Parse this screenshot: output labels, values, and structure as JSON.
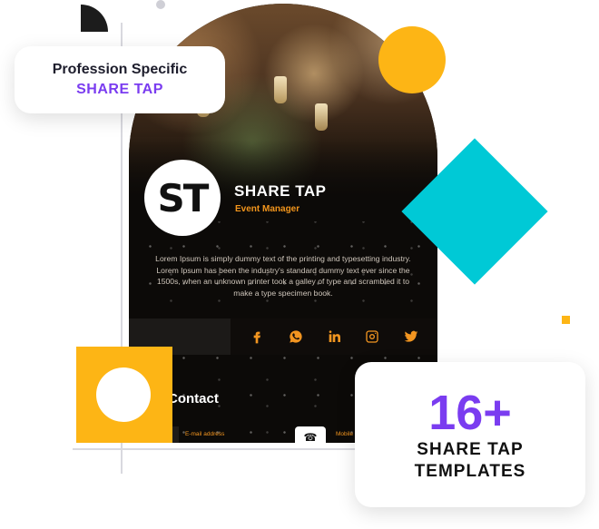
{
  "profession_card": {
    "line1": "Profession Specific",
    "line2": "SHARE TAP"
  },
  "profile": {
    "avatar_text": "ST",
    "name": "SHARE TAP",
    "role": "Event Manager",
    "bio": "Lorem Ipsum is simply dummy text of the printing and typesetting industry. Lorem Ipsum has been the industry's standard dummy text ever since the 1500s, when an unknown printer took a galley of type and scrambled it to make a type specimen book."
  },
  "social": [
    {
      "name": "facebook-icon"
    },
    {
      "name": "whatsapp-icon"
    },
    {
      "name": "linkedin-icon"
    },
    {
      "name": "instagram-icon"
    },
    {
      "name": "twitter-icon"
    }
  ],
  "contact": {
    "title": "Contact",
    "email_label": "E-mail address",
    "mobile_label": "Mobile"
  },
  "templates_card": {
    "count": "16+",
    "line1": "SHARE TAP",
    "line2": "TEMPLATES"
  },
  "colors": {
    "accent_purple": "#7a3cf0",
    "accent_orange": "#f29520",
    "yellow": "#fdb515",
    "cyan": "#00c9d6"
  }
}
